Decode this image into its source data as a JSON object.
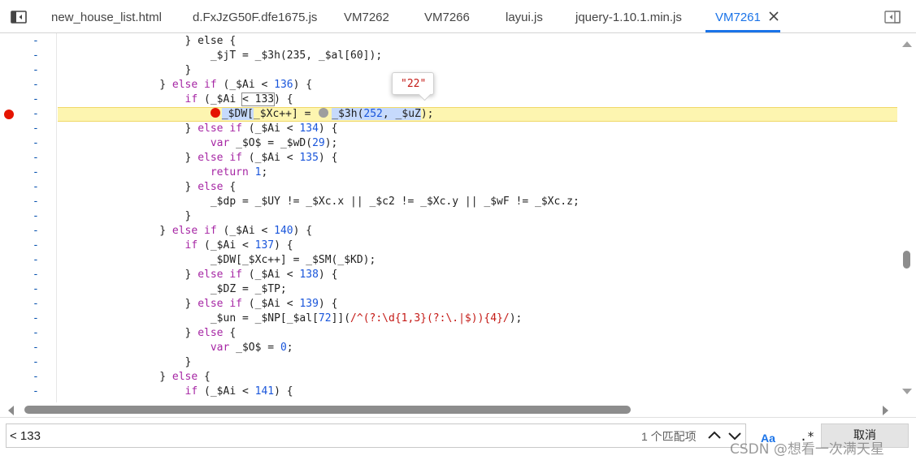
{
  "tabs": [
    {
      "label": "new_house_list.html",
      "active": false
    },
    {
      "label": "d.FxJzG50F.dfe1675.js",
      "active": false
    },
    {
      "label": "VM7262",
      "active": false
    },
    {
      "label": "VM7266",
      "active": false
    },
    {
      "label": "layui.js",
      "active": false
    },
    {
      "label": "jquery-1.10.1.min.js",
      "active": false
    },
    {
      "label": "VM7261",
      "active": true
    }
  ],
  "gutter": {
    "marker": "-"
  },
  "code": {
    "l0": "                    } else {",
    "l1": "                        _$jT = _$3h(235, _$al[60]);",
    "l2": "                    }",
    "l3_a": "                } ",
    "l3_kw1": "else",
    "l3_b": " ",
    "l3_kw2": "if",
    "l3_c": " (_$Ai < ",
    "l3_num": "136",
    "l3_d": ") {",
    "l4_a": "                    ",
    "l4_kw": "if",
    "l4_b": " (_$Ai ",
    "l4_box": "< 133",
    "l4_c": ") {",
    "l5_pre": "                        ",
    "l5_sel1": "_$DW[",
    "l5_a": "_$Xc++] = ",
    "l5_sel2": "_$3h(",
    "l5_num1": "252",
    "l5_b": ", _$uZ",
    "l5_c": ");",
    "l6_a": "                    } ",
    "l6_kw1": "else",
    "l6_b": " ",
    "l6_kw2": "if",
    "l6_c": " (_$Ai < ",
    "l6_num": "134",
    "l6_d": ") {",
    "l7_a": "                        ",
    "l7_kw": "var",
    "l7_b": " _$O$ = _$wD(",
    "l7_num": "29",
    "l7_c": ");",
    "l8_a": "                    } ",
    "l8_kw1": "else",
    "l8_b": " ",
    "l8_kw2": "if",
    "l8_c": " (_$Ai < ",
    "l8_num": "135",
    "l8_d": ") {",
    "l9_a": "                        ",
    "l9_kw": "return",
    "l9_b": " ",
    "l9_num": "1",
    "l9_c": ";",
    "l10_a": "                    } ",
    "l10_kw": "else",
    "l10_b": " {",
    "l11": "                        _$dp = _$UY != _$Xc.x || _$c2 != _$Xc.y || _$wF != _$Xc.z;",
    "l12": "                    }",
    "l13_a": "                } ",
    "l13_kw1": "else",
    "l13_b": " ",
    "l13_kw2": "if",
    "l13_c": " (_$Ai < ",
    "l13_num": "140",
    "l13_d": ") {",
    "l14_a": "                    ",
    "l14_kw": "if",
    "l14_b": " (_$Ai < ",
    "l14_num": "137",
    "l14_c": ") {",
    "l15": "                        _$DW[_$Xc++] = _$SM(_$KD);",
    "l16_a": "                    } ",
    "l16_kw1": "else",
    "l16_b": " ",
    "l16_kw2": "if",
    "l16_c": " (_$Ai < ",
    "l16_num": "138",
    "l16_d": ") {",
    "l17": "                        _$DZ = _$TP;",
    "l18_a": "                    } ",
    "l18_kw1": "else",
    "l18_b": " ",
    "l18_kw2": "if",
    "l18_c": " (_$Ai < ",
    "l18_num": "139",
    "l18_d": ") {",
    "l19_a": "                        _$un = _$NP[_$al[",
    "l19_num": "72",
    "l19_b": "]](",
    "l19_rx": "/^(?:\\d{1,3}(?:\\.|$)){4}/",
    "l19_c": ");",
    "l20_a": "                    } ",
    "l20_kw": "else",
    "l20_b": " {",
    "l21_a": "                        ",
    "l21_kw": "var",
    "l21_b": " _$O$ = ",
    "l21_num": "0",
    "l21_c": ";",
    "l22": "                    }",
    "l23_a": "                } ",
    "l23_kw": "else",
    "l23_b": " {",
    "l24_a": "                    ",
    "l24_kw": "if",
    "l24_b": " (_$Ai < ",
    "l24_num": "141",
    "l24_c": ") {"
  },
  "tooltip": {
    "value": "\"22\""
  },
  "search": {
    "value": "< 133",
    "match_count": "1 个匹配项",
    "match_case_label": "Aa",
    "regex_label": ".*",
    "cancel_label": "取消"
  },
  "watermark": "CSDN @想看一次满天星",
  "colors": {
    "accent": "#1a73e8",
    "breakpoint": "#e51400",
    "current_line": "#fdf5b0",
    "keyword": "#a626a4",
    "number": "#1a56db",
    "string": "#c41a16"
  }
}
